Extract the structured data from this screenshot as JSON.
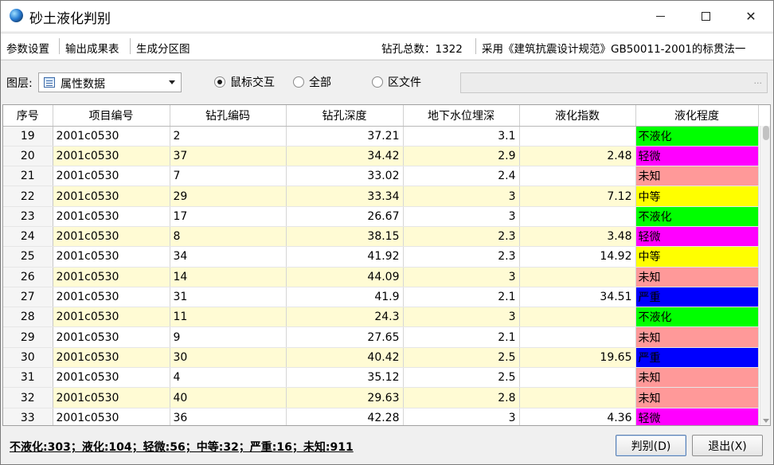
{
  "window": {
    "title": "砂土液化判别"
  },
  "menu": {
    "items": [
      "参数设置",
      "输出成果表",
      "生成分区图"
    ],
    "hole_count": "钻孔总数：1322",
    "standard": "采用《建筑抗震设计规范》GB50011-2001的标贯法一"
  },
  "toolbar": {
    "layer_label": "图层:",
    "layer_value": "属性数据",
    "radios": [
      {
        "label": "鼠标交互",
        "checked": true
      },
      {
        "label": "全部",
        "checked": false
      },
      {
        "label": "区文件",
        "checked": false
      }
    ],
    "file_button": "..."
  },
  "grid": {
    "columns": [
      "序号",
      "项目编号",
      "钻孔编码",
      "钻孔深度",
      "地下水位埋深",
      "液化指数",
      "液化程度"
    ],
    "rows": [
      [
        "19",
        "2001c0530",
        "2",
        "37.21",
        "3.1",
        "",
        "不液化"
      ],
      [
        "20",
        "2001c0530",
        "37",
        "34.42",
        "2.9",
        "2.48",
        "轻微"
      ],
      [
        "21",
        "2001c0530",
        "7",
        "33.02",
        "2.4",
        "",
        "未知"
      ],
      [
        "22",
        "2001c0530",
        "29",
        "33.34",
        "3",
        "7.12",
        "中等"
      ],
      [
        "23",
        "2001c0530",
        "17",
        "26.67",
        "3",
        "",
        "不液化"
      ],
      [
        "24",
        "2001c0530",
        "8",
        "38.15",
        "2.3",
        "3.48",
        "轻微"
      ],
      [
        "25",
        "2001c0530",
        "34",
        "41.92",
        "2.3",
        "14.92",
        "中等"
      ],
      [
        "26",
        "2001c0530",
        "14",
        "44.09",
        "3",
        "",
        "未知"
      ],
      [
        "27",
        "2001c0530",
        "31",
        "41.9",
        "2.1",
        "34.51",
        "严重"
      ],
      [
        "28",
        "2001c0530",
        "11",
        "24.3",
        "3",
        "",
        "不液化"
      ],
      [
        "29",
        "2001c0530",
        "9",
        "27.65",
        "2.1",
        "",
        "未知"
      ],
      [
        "30",
        "2001c0530",
        "30",
        "40.42",
        "2.5",
        "19.65",
        "严重"
      ],
      [
        "31",
        "2001c0530",
        "4",
        "35.12",
        "2.5",
        "",
        "未知"
      ],
      [
        "32",
        "2001c0530",
        "40",
        "29.63",
        "2.8",
        "",
        "未知"
      ],
      [
        "33",
        "2001c0530",
        "36",
        "42.28",
        "3",
        "4.36",
        "轻微"
      ]
    ],
    "level_colors": {
      "不液化": "#00ff00",
      "轻微": "#ff00ff",
      "未知": "#ff9999",
      "中等": "#ffff00",
      "严重": "#0000ff"
    }
  },
  "status": {
    "summary": "不液化:303；液化:104；轻微:56；中等:32；严重:16；未知:911"
  },
  "buttons": {
    "judge": "判别(D)",
    "exit": "退出(X)"
  }
}
